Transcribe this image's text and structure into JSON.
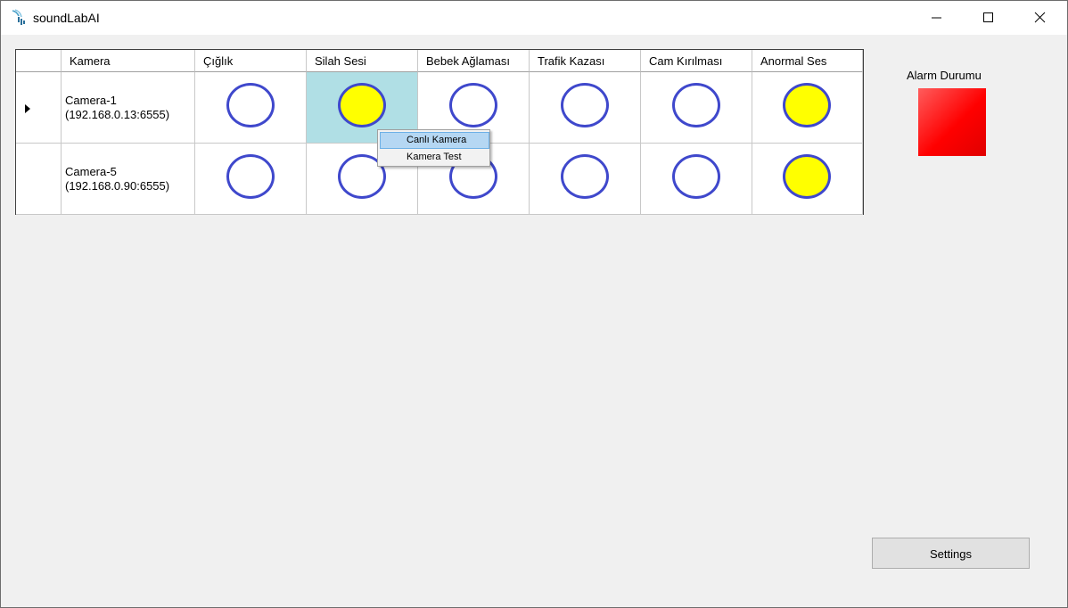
{
  "window": {
    "title": "soundLabAI",
    "icon": "soundlab-app-icon",
    "controls": [
      "minimize-icon",
      "maximize-icon",
      "close-icon"
    ]
  },
  "grid": {
    "columns": [
      "Kamera",
      "Çığlık",
      "Silah Sesi",
      "Bebek Ağlaması",
      "Trafik Kazası",
      "Cam Kırılması",
      "Anormal Ses"
    ],
    "rows": [
      {
        "camera": "Camera-1\n(192.168.0.13:6555)",
        "current": true,
        "alerts": [
          false,
          true,
          false,
          false,
          false,
          true
        ],
        "selected_col": 1
      },
      {
        "camera": "Camera-5\n(192.168.0.90:6555)",
        "current": false,
        "alerts": [
          false,
          false,
          false,
          false,
          false,
          true
        ],
        "selected_col": -1
      }
    ],
    "indicator_on_color": "#ffff00",
    "indicator_border_color": "#3f48cc"
  },
  "context_menu": {
    "items": [
      "Canlı Kamera",
      "Kamera Test"
    ],
    "highlighted_index": 0
  },
  "alarm": {
    "label": "Alarm Durumu",
    "color": "#ff0000"
  },
  "settings_button": "Settings"
}
